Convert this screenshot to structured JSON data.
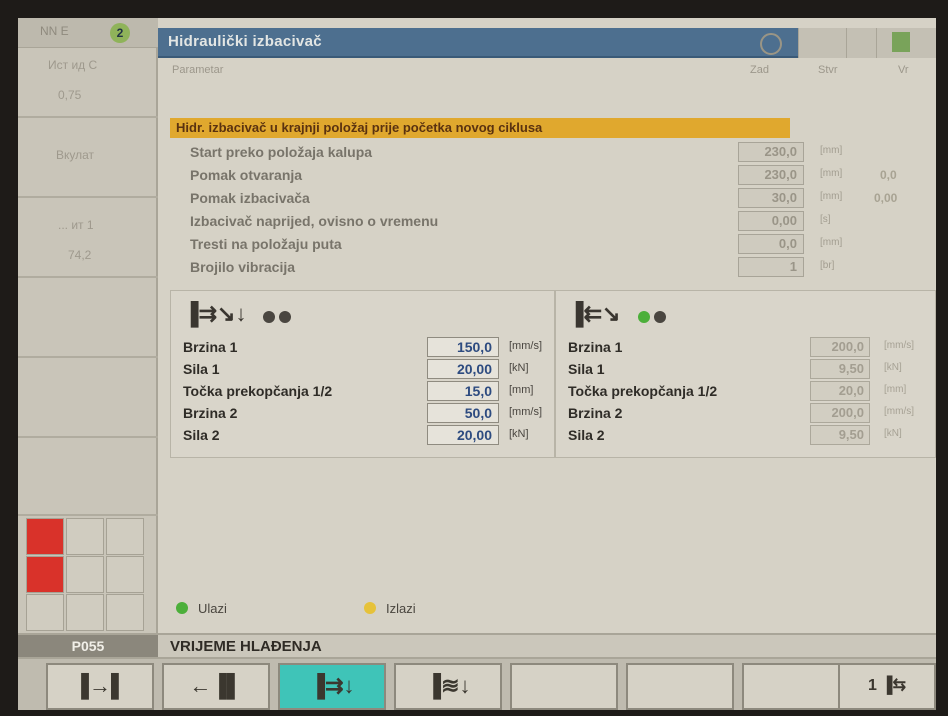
{
  "window": {
    "title": "Hidraulički izbacivač",
    "screen_number": "NN E",
    "badge": "2"
  },
  "left_panel": {
    "cells": [
      "Ист ид C",
      "0,75",
      "Вкулат",
      "",
      "... ит 1",
      "74,2"
    ]
  },
  "column_headers": {
    "param": "Parametar",
    "set": "Zad",
    "actual": "Stvr",
    "extra": "Vr"
  },
  "section": {
    "title": "Hidr. izbacivač u krajnji položaj prije početka novog ciklusa"
  },
  "params": [
    {
      "label": "Start preko položaja kalupa",
      "value": "230,0",
      "unit": "[mm]"
    },
    {
      "label": "Pomak otvaranja",
      "value": "230,0",
      "unit": "[mm]"
    },
    {
      "label": "Pomak izbacivača",
      "value": "30,0",
      "unit": "[mm]"
    },
    {
      "label": "Izbacivač naprijed, ovisno o vremenu",
      "value": "0,00",
      "unit": "[s]"
    },
    {
      "label": "Tresti na položaju puta",
      "value": "0,0",
      "unit": "[mm]"
    },
    {
      "label": "Brojilo vibracija",
      "value": "1",
      "unit": "[br]"
    }
  ],
  "extra_values": [
    "0,0",
    "0,00"
  ],
  "forward": {
    "rows": [
      {
        "label": "Brzina 1",
        "value": "150,0",
        "unit": "[mm/s]"
      },
      {
        "label": "Sila 1",
        "value": "20,00",
        "unit": "[kN]"
      },
      {
        "label": "Točka prekopčanja 1/2",
        "value": "15,0",
        "unit": "[mm]"
      },
      {
        "label": "Brzina 2",
        "value": "50,0",
        "unit": "[mm/s]"
      },
      {
        "label": "Sila 2",
        "value": "20,00",
        "unit": "[kN]"
      }
    ]
  },
  "backward": {
    "rows": [
      {
        "label": "Brzina 1",
        "value": "200,0",
        "unit": "[mm/s]"
      },
      {
        "label": "Sila 1",
        "value": "9,50",
        "unit": "[kN]"
      },
      {
        "label": "Točka prekopčanja 1/2",
        "value": "20,0",
        "unit": "[mm]"
      },
      {
        "label": "Brzina 2",
        "value": "200,0",
        "unit": "[mm/s]"
      },
      {
        "label": "Sila 2",
        "value": "9,50",
        "unit": "[kN]"
      }
    ]
  },
  "legend": {
    "inputs": "Ulazi",
    "outputs": "Izlazi"
  },
  "status": {
    "code": "P055",
    "message": "VRIJEME HLAĐENJA"
  },
  "softkeys": {
    "badge": "1"
  },
  "colors": {
    "title_bar": "#4d6f8f",
    "section_bar": "#e0a82e",
    "active_key": "#3fc4b8",
    "value_blue": "#2d4b80",
    "alarm_red": "#d9322a",
    "ok_green": "#4caf3a",
    "out_yellow": "#e6c23a"
  },
  "icons": [
    "ejector-forward-icon",
    "ejector-backward-icon",
    "mold-open-icon",
    "mold-close-icon",
    "ejector-shake-icon",
    "clock-icon"
  ]
}
